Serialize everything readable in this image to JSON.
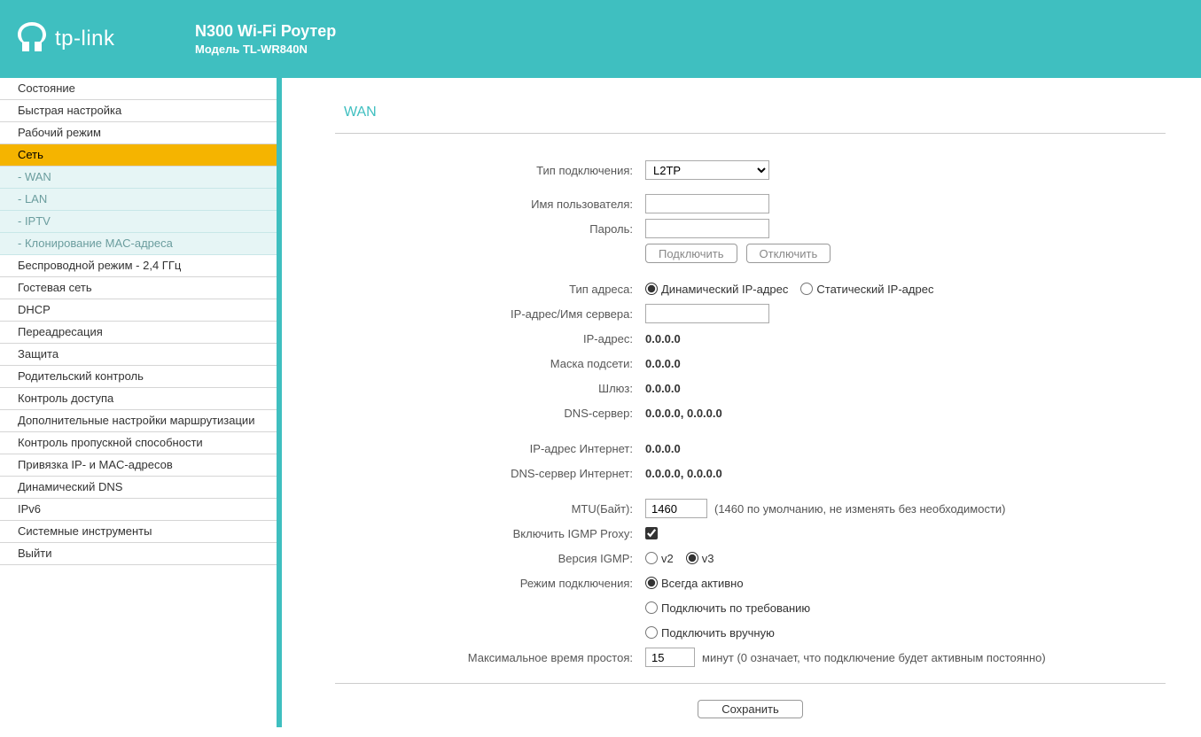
{
  "header": {
    "brand": "tp-link",
    "title": "N300 Wi-Fi Роутер",
    "model": "Модель TL-WR840N"
  },
  "sidebar": {
    "items": [
      {
        "label": "Состояние",
        "type": "item"
      },
      {
        "label": "Быстрая настройка",
        "type": "item"
      },
      {
        "label": "Рабочий режим",
        "type": "item"
      },
      {
        "label": "Сеть",
        "type": "active"
      },
      {
        "label": "- WAN",
        "type": "sub"
      },
      {
        "label": "- LAN",
        "type": "sub"
      },
      {
        "label": "- IPTV",
        "type": "sub"
      },
      {
        "label": "- Клонирование MAC-адреса",
        "type": "sub"
      },
      {
        "label": "Беспроводной режим - 2,4 ГГц",
        "type": "item"
      },
      {
        "label": "Гостевая сеть",
        "type": "item"
      },
      {
        "label": "DHCP",
        "type": "item"
      },
      {
        "label": "Переадресация",
        "type": "item"
      },
      {
        "label": "Защита",
        "type": "item"
      },
      {
        "label": "Родительский контроль",
        "type": "item"
      },
      {
        "label": "Контроль доступа",
        "type": "item"
      },
      {
        "label": "Дополнительные настройки маршрутизации",
        "type": "item"
      },
      {
        "label": "Контроль пропускной способности",
        "type": "item"
      },
      {
        "label": "Привязка IP- и MAC-адресов",
        "type": "item"
      },
      {
        "label": "Динамический DNS",
        "type": "item"
      },
      {
        "label": "IPv6",
        "type": "item"
      },
      {
        "label": "Системные инструменты",
        "type": "item"
      },
      {
        "label": "Выйти",
        "type": "item"
      }
    ]
  },
  "page": {
    "title": "WAN",
    "labels": {
      "conn_type": "Тип подключения:",
      "username": "Имя пользователя:",
      "password": "Пароль:",
      "connect": "Подключить",
      "disconnect": "Отключить",
      "addr_type": "Тип адреса:",
      "dynamic_ip": "Динамический IP-адрес",
      "static_ip": "Статический IP-адрес",
      "server_ip": "IP-адрес/Имя сервера:",
      "ip_addr": "IP-адрес:",
      "subnet": "Маска подсети:",
      "gateway": "Шлюз:",
      "dns": "DNS-сервер:",
      "inet_ip": "IP-адрес Интернет:",
      "inet_dns": "DNS-сервер Интернет:",
      "mtu": "MTU(Байт):",
      "mtu_note": "(1460 по умолчанию, не изменять без необходимости)",
      "igmp_proxy": "Включить IGMP Proxy:",
      "igmp_ver": "Версия IGMP:",
      "v2": "v2",
      "v3": "v3",
      "conn_mode": "Режим подключения:",
      "always": "Всегда активно",
      "on_demand": "Подключить по требованию",
      "manual": "Подключить вручную",
      "idle": "Максимальное время простоя:",
      "idle_unit": "минут (0 означает, что подключение будет активным постоянно)",
      "save": "Сохранить"
    },
    "values": {
      "conn_type": "L2TP",
      "username": "",
      "password": "",
      "server_ip": "",
      "ip_addr": "0.0.0.0",
      "subnet": "0.0.0.0",
      "gateway": "0.0.0.0",
      "dns": "0.0.0.0,   0.0.0.0",
      "inet_ip": "0.0.0.0",
      "inet_dns": "0.0.0.0,   0.0.0.0",
      "mtu": "1460",
      "idle": "15"
    }
  }
}
